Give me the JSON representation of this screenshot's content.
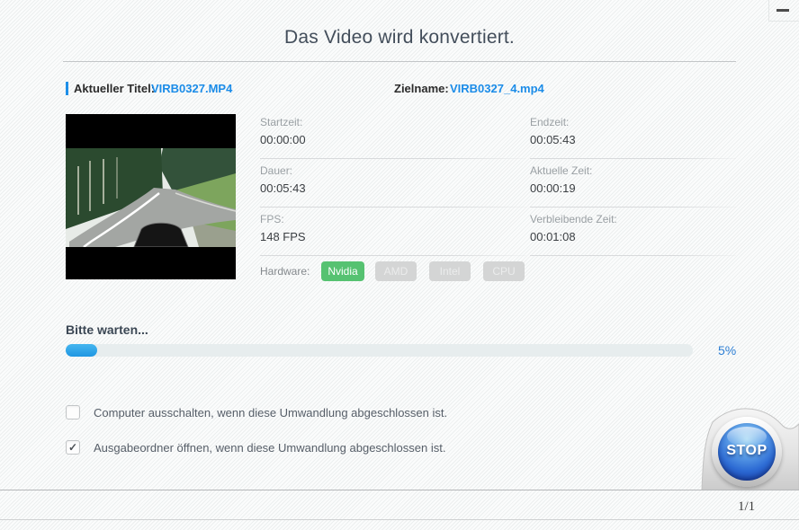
{
  "window": {
    "title": "Das Video wird konvertiert.",
    "icons": {
      "minimize": "minimize-dash"
    }
  },
  "files": {
    "current_label": "Aktueller Titel:",
    "current_name": "VIRB0327.MP4",
    "target_label": "Zielname:",
    "target_name": "VIRB0327_4.mp4"
  },
  "info_fields": [
    {
      "label": "Startzeit:",
      "value": "00:00:00"
    },
    {
      "label": "Endzeit:",
      "value": "00:05:43"
    },
    {
      "label": "Dauer:",
      "value": "00:05:43"
    },
    {
      "label": "Aktuelle Zeit:",
      "value": "00:00:19"
    },
    {
      "label": "FPS:",
      "value": "148 FPS"
    },
    {
      "label": "Verbleibende Zeit:",
      "value": "00:01:08"
    }
  ],
  "hardware": {
    "label": "Hardware:",
    "options": [
      {
        "name": "Nvidia",
        "active": true
      },
      {
        "name": "AMD",
        "active": false
      },
      {
        "name": "Intel",
        "active": false
      },
      {
        "name": "CPU",
        "active": false
      }
    ]
  },
  "progress": {
    "status_text": "Bitte warten...",
    "percent": 5,
    "percent_label": "5%"
  },
  "options": [
    {
      "label": "Computer ausschalten, wenn diese Umwandlung abgeschlossen ist.",
      "checked": false,
      "mark": ""
    },
    {
      "label": "Ausgabeordner öffnen, wenn diese Umwandlung abgeschlossen ist.",
      "checked": true,
      "mark": "✓"
    }
  ],
  "stop_button": {
    "label": "STOP"
  },
  "footer": {
    "page_indicator": "1/1"
  },
  "colors": {
    "accent_blue": "#1B8CE8",
    "progress_blue": "#29A0E8",
    "nvidia_green": "#56C271",
    "title_text": "#434E5B",
    "stop_blue": "#2D6BD4"
  }
}
